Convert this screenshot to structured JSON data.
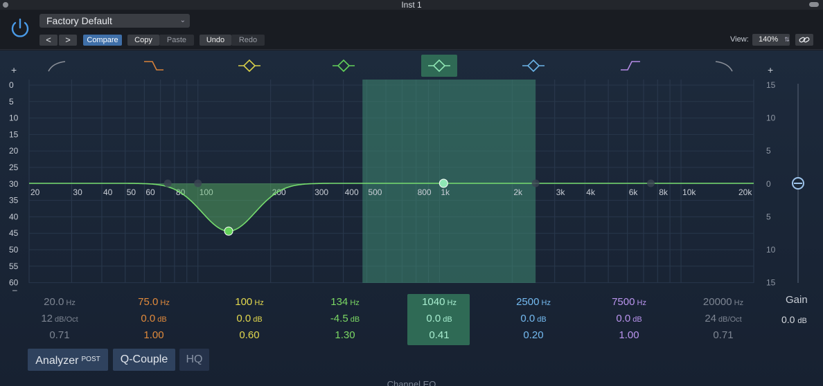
{
  "window": {
    "title": "Inst 1"
  },
  "header": {
    "preset": "Factory Default",
    "nav_prev": "<",
    "nav_next": ">",
    "compare": "Compare",
    "copy": "Copy",
    "paste": "Paste",
    "undo": "Undo",
    "redo": "Redo",
    "view_label": "View:",
    "view_value": "140%"
  },
  "graph": {
    "db_labels_left": [
      "0",
      "5",
      "10",
      "15",
      "20",
      "25",
      "30",
      "35",
      "40",
      "45",
      "50",
      "55",
      "60"
    ],
    "db_labels_right": [
      "15",
      "10",
      "5",
      "0",
      "5",
      "10",
      "15"
    ],
    "freq_labels": [
      "20",
      "30",
      "40",
      "50",
      "60",
      "80",
      "100",
      "200",
      "300",
      "400",
      "500",
      "800",
      "1k",
      "2k",
      "3k",
      "4k",
      "6k",
      "8k",
      "10k",
      "20k"
    ],
    "selected_band_range_hz": [
      480,
      2500
    ],
    "bands": [
      {
        "freq": 20,
        "gain": 0,
        "active": false,
        "color": "#8a8f98",
        "icon": "low-cut-icon"
      },
      {
        "freq": 75,
        "gain": 0,
        "active": false,
        "color": "#d9823a",
        "icon": "low-shelf-icon"
      },
      {
        "freq": 100,
        "gain": 0,
        "active": false,
        "color": "#d9d04a",
        "icon": "peak-band-icon"
      },
      {
        "freq": 134,
        "gain": -4.5,
        "active": true,
        "color": "#63d15a",
        "icon": "peak-band-icon"
      },
      {
        "freq": 1040,
        "gain": 0,
        "active": true,
        "color": "#8fe6b4",
        "icon": "peak-band-icon"
      },
      {
        "freq": 2500,
        "gain": 0,
        "active": false,
        "color": "#6cb5e8",
        "icon": "peak-band-icon"
      },
      {
        "freq": 7500,
        "gain": 0,
        "active": false,
        "color": "#b48ae6",
        "icon": "high-shelf-icon"
      },
      {
        "freq": 20000,
        "gain": 0,
        "active": false,
        "color": "#8a8f98",
        "icon": "high-cut-icon"
      }
    ]
  },
  "bands": [
    {
      "freq": "20.0",
      "freq_unit": "Hz",
      "gain": "12",
      "gain_unit": "dB/Oct",
      "q": "0.71",
      "color": "#7d8592"
    },
    {
      "freq": "75.0",
      "freq_unit": "Hz",
      "gain": "0.0",
      "gain_unit": "dB",
      "q": "1.00",
      "color": "#e08a3c"
    },
    {
      "freq": "100",
      "freq_unit": "Hz",
      "gain": "0.0",
      "gain_unit": "dB",
      "q": "0.60",
      "color": "#e2d84e"
    },
    {
      "freq": "134",
      "freq_unit": "Hz",
      "gain": "-4.5",
      "gain_unit": "dB",
      "q": "1.30",
      "color": "#7bd864"
    },
    {
      "freq": "1040",
      "freq_unit": "Hz",
      "gain": "0.0",
      "gain_unit": "dB",
      "q": "0.41",
      "color": "#a8eed0"
    },
    {
      "freq": "2500",
      "freq_unit": "Hz",
      "gain": "0.0",
      "gain_unit": "dB",
      "q": "0.20",
      "color": "#74baf0"
    },
    {
      "freq": "7500",
      "freq_unit": "Hz",
      "gain": "0.0",
      "gain_unit": "dB",
      "q": "1.00",
      "color": "#b994ee"
    },
    {
      "freq": "20000",
      "freq_unit": "Hz",
      "gain": "24",
      "gain_unit": "dB/Oct",
      "q": "0.71",
      "color": "#7d8592"
    }
  ],
  "output": {
    "label": "Gain",
    "value": "0.0",
    "unit": "dB"
  },
  "footer_buttons": {
    "analyzer": "Analyzer",
    "analyzer_mode": "POST",
    "qcouple": "Q-Couple",
    "hq": "HQ"
  },
  "footer": {
    "title": "Channel EQ"
  }
}
